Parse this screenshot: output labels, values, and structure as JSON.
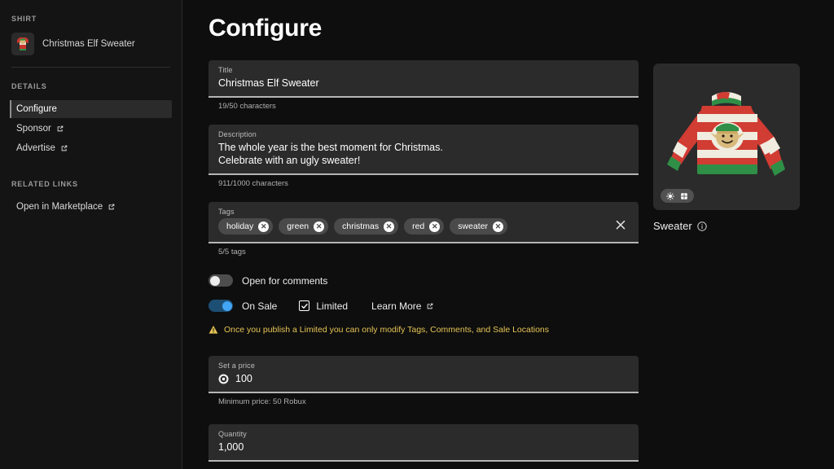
{
  "sidebar": {
    "asset_type_label": "SHIRT",
    "asset_name": "Christmas Elf Sweater",
    "details_label": "DETAILS",
    "nav_items": [
      {
        "label": "Configure",
        "external": false,
        "active": true
      },
      {
        "label": "Sponsor",
        "external": true,
        "active": false
      },
      {
        "label": "Advertise",
        "external": true,
        "active": false
      }
    ],
    "related_links_label": "RELATED LINKS",
    "related_links": [
      {
        "label": "Open in Marketplace",
        "external": true
      }
    ]
  },
  "main": {
    "page_title": "Configure",
    "title_field": {
      "label": "Title",
      "value": "Christmas Elf Sweater",
      "helper": "19/50 characters"
    },
    "description_field": {
      "label": "Description",
      "line1": "The whole year is the best moment for Christmas.",
      "line2": "Celebrate with an ugly sweater!",
      "helper": "911/1000 characters"
    },
    "tags_field": {
      "label": "Tags",
      "tags": [
        "holiday",
        "green",
        "christmas",
        "red",
        "sweater"
      ],
      "remove_glyph": "✕",
      "helper": "5/5 tags"
    },
    "comments_toggle": {
      "label": "Open for comments",
      "state": "off"
    },
    "sale_toggle": {
      "label": "On Sale",
      "state": "on"
    },
    "limited_checkbox": {
      "label": "Limited",
      "checked": true
    },
    "learn_more": {
      "label": "Learn More",
      "external": true
    },
    "warning": {
      "text": "Once you publish a Limited you can only modify Tags, Comments, and Sale Locations"
    },
    "price_field": {
      "label": "Set a price",
      "value": "100",
      "helper": "Minimum price: 50 Robux"
    },
    "quantity_field": {
      "label": "Quantity",
      "value": "1,000"
    }
  },
  "preview": {
    "caption": "Sweater",
    "lighting_icon": "sun-burst-icon",
    "texture_icon": "texture-grid-icon",
    "info_icon": "info-icon"
  },
  "colors": {
    "page_bg": "#0e0e0e",
    "sidebar_bg": "#141414",
    "field_bg": "#2b2b2b",
    "accent_blue": "#42a5f5",
    "warning_yellow": "#e5c455"
  }
}
